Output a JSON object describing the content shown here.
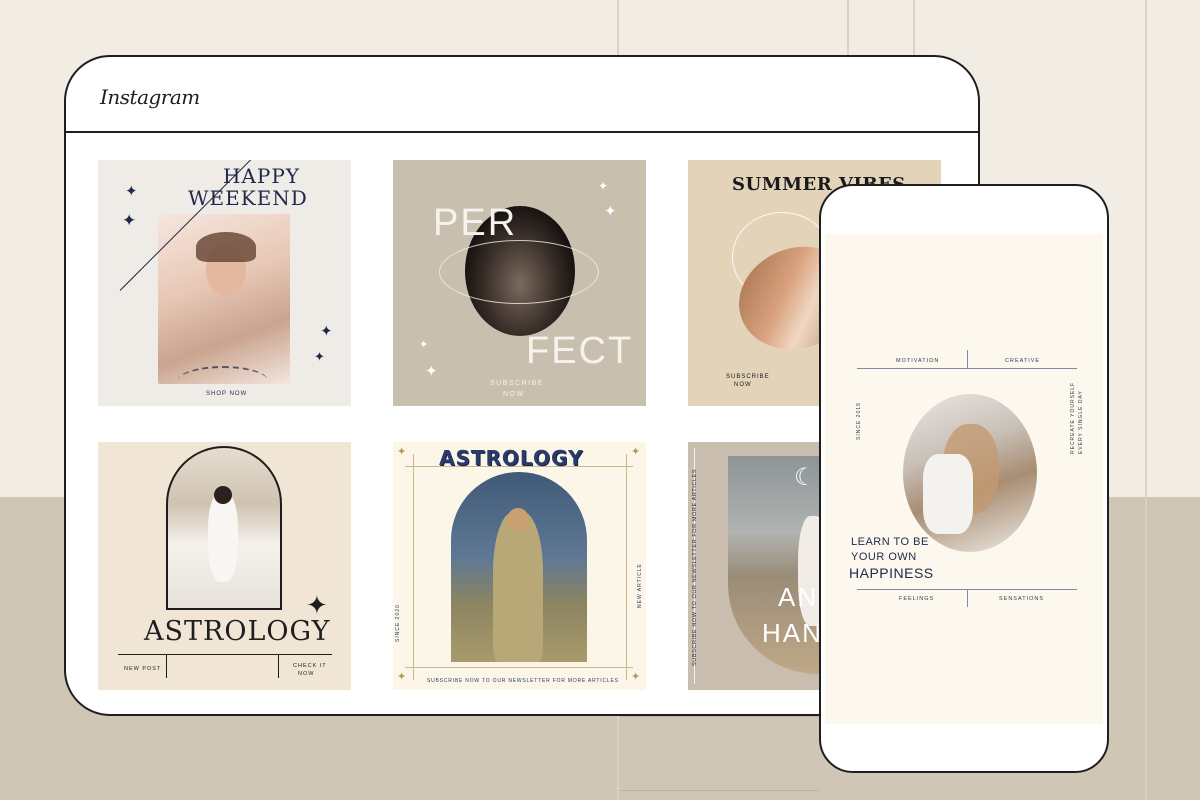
{
  "browser": {
    "logo": "Instagram"
  },
  "posts": {
    "p1": {
      "title_line1": "HAPPY",
      "title_line2": "WEEKEND",
      "cta": "SHOP NOW"
    },
    "p2": {
      "title_top": "PER",
      "title_bottom": "FECT",
      "cta_line1": "SUBSCRIBE",
      "cta_line2": "NOW"
    },
    "p3": {
      "title": "SUMMER VIBES",
      "cta_line1": "SUBSCRIBE",
      "cta_line2": "NOW"
    },
    "p4": {
      "title": "ASTROLOGY",
      "left_line1": "NEW POST",
      "right_line1": "CHECK IT",
      "right_line2": "NOW"
    },
    "p5": {
      "title": "ASTROLOGY",
      "side_left": "SINCE 2020",
      "side_right": "NEW ARTICLE",
      "footer": "SUBSCRIBE NOW TO OUR NEWSLETTER FOR MORE ARTICLES"
    },
    "p6": {
      "side_text": "SUBSCRIBE NOW TO OUR NEWSLETTER FOR MORE ARTICLES",
      "name_line1": "ANN",
      "name_line2": "HANS"
    }
  },
  "phone": {
    "top_left": "MOTIVATION",
    "top_right": "CREATIVE",
    "side_left": "SINCE 2019",
    "side_right_line1": "RECREATE YOURSELF",
    "side_right_line2": "EVERY SINGLE DAY",
    "headline_line1": "LEARN TO BE",
    "headline_line2": "YOUR OWN",
    "headline_line3": "HAPPINESS",
    "bottom_left": "FEELINGS",
    "bottom_right": "SENSATIONS"
  },
  "colors": {
    "background": "#f1ece4",
    "background_bottom": "#d0c6b5",
    "navy": "#1f2a4a",
    "beige": "#c8bfaf"
  },
  "icons": [
    "sparkle-icon",
    "moon-icon",
    "sunburst-icon"
  ]
}
